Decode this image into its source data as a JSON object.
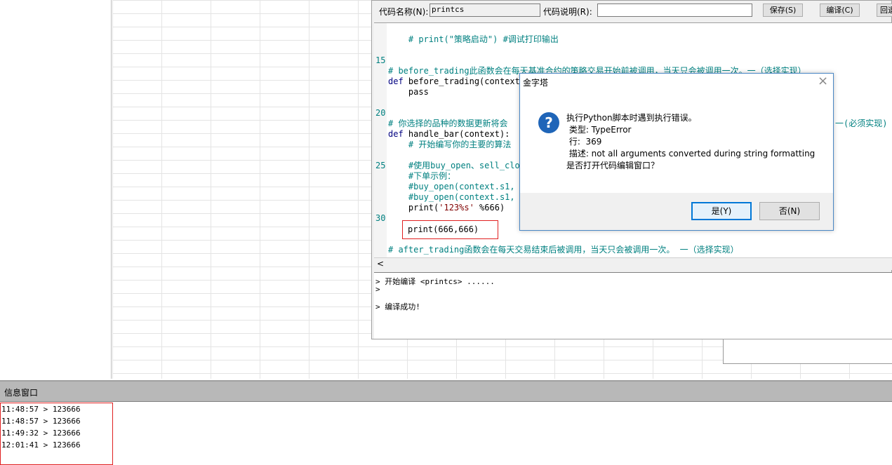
{
  "toolbar": {
    "code_name_label": "代码名称(N):",
    "code_name_value": "printcs",
    "code_desc_label": "代码说明(R):",
    "code_desc_value": "",
    "save_label": "保存(S)",
    "compile_label": "编译(C)",
    "back_label": "回退"
  },
  "code_lines": {
    "l1": "    # print(\"策略启动\") #调试打印输出",
    "l2": "# before_trading此函数会在每天基准合约的策略交易开始前被调用，当天只会被调用一次。一（选择实现）",
    "l3_def": "def",
    "l3_rest": " before_trading(context):",
    "l4": "    pass",
    "l5": "# 你选择的品种的数据更新将会",
    "l5_right": "一(必须实现)",
    "l6_def": "def",
    "l6_rest": " handle_bar(context):",
    "l7": "    # 开始编写你的主要的算法",
    "l8": "    #使用buy_open、sell_clo",
    "l9": "    #下单示例：",
    "l10": "    #buy_open(context.s1, \"",
    "l11": "    #buy_open(context.s1, \"",
    "l12_a": "    print(",
    "l12_str": "'123%s'",
    "l12_b": " %666)",
    "l13": "print(666,666)",
    "l14": "# after_trading函数会在每天交易结束后被调用，当天只会被调用一次。 一（选择实现）"
  },
  "line_numbers": [
    "15",
    "20",
    "25",
    "30"
  ],
  "output": {
    "line1": "> 开始编译 <printcs> ......",
    "line2": ">",
    "line3": "> 编译成功!"
  },
  "dialog": {
    "title": "金字塔",
    "close": "×",
    "icon": "?",
    "message1": "执行Python脚本时遇到执行错误。",
    "type_line": " 类型: TypeError",
    "row_line": " 行:  369",
    "desc_line": " 描述: not all arguments converted during string formatting",
    "question": "是否打开代码编辑窗口？",
    "yes_label": "是(Y)",
    "no_label": "否(N)"
  },
  "info": {
    "title": "信息窗口",
    "logs": [
      "11:48:57 > 123666",
      "11:48:57 > 123666",
      "11:49:32 > 123666",
      "12:01:41 > 123666"
    ]
  },
  "scroll": {
    "left_arrow": "<"
  }
}
